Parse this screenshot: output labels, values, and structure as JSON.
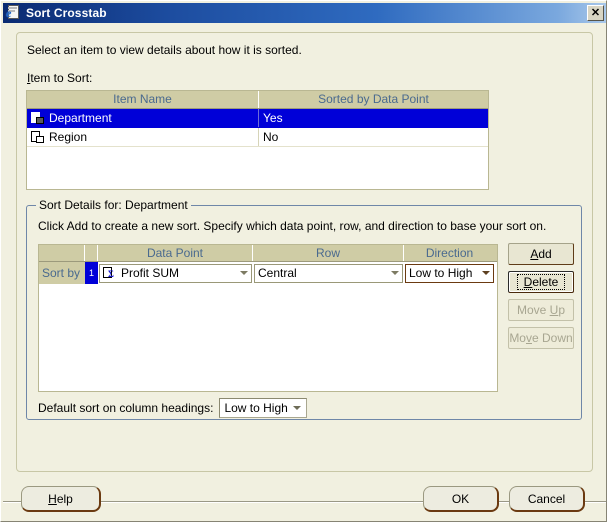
{
  "window": {
    "title": "Sort Crosstab",
    "icon": "ie-document-icon",
    "close_label": "✕"
  },
  "content": {
    "intro_text": "Select an item to view details about how it is sorted.",
    "item_to_sort_label": "Item to Sort:"
  },
  "item_grid": {
    "columns": [
      "Item Name",
      "Sorted by Data Point"
    ],
    "rows": [
      {
        "icon": "attribute-icon",
        "name": "Department",
        "sorted": "Yes",
        "selected": true
      },
      {
        "icon": "attribute-icon",
        "name": "Region",
        "sorted": "No",
        "selected": false
      }
    ]
  },
  "sort_details": {
    "group_title": "Sort Details for: Department",
    "instruction": "Click Add to create a new sort. Specify which data point, row, and direction to base your sort on.",
    "columns": [
      "",
      "",
      "Data Point",
      "Row",
      "Direction"
    ],
    "row": {
      "sort_by_label": "Sort by",
      "marker": "1",
      "data_point": "Profit SUM",
      "data_point_icon": "sigma-metric-icon",
      "row_value": "Central",
      "direction": "Low to High"
    },
    "buttons": {
      "add": "Add",
      "add_mnemonic": "A",
      "delete": "Delete",
      "delete_mnemonic": "D",
      "move_up": "Move Up",
      "move_down": "Move Down"
    }
  },
  "default_sort": {
    "label": "Default sort on column headings:",
    "value": "Low to High"
  },
  "footer": {
    "help": "Help",
    "ok": "OK",
    "cancel": "Cancel"
  },
  "colors": {
    "titlebar_start": "#0a2a72",
    "titlebar_end": "#a9c8ea",
    "dialog_bg": "#f1f0e0",
    "header_bg": "#cfcca5",
    "header_text": "#4a6a8f",
    "selection_bg": "#0000d8",
    "selection_text": "#ffffff",
    "button_shadow": "#6b3a11",
    "groupbox_border": "#6f87a8",
    "disabled_text": "#a8a691"
  }
}
